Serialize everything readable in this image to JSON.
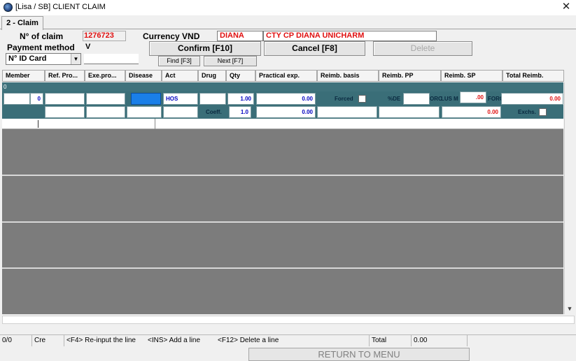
{
  "window": {
    "title": "[Lisa / SB] CLIENT CLAIM",
    "close_glyph": "✕"
  },
  "tabs": [
    {
      "label": "2 - Claim"
    }
  ],
  "header": {
    "claim_no_label": "N° of claim",
    "claim_no_value": "1276723",
    "currency_label": "Currency VND",
    "client_code": "DIANA",
    "client_name": "CTY CP DIANA UNICHARM",
    "payment_method_label": "Payment method",
    "payment_method_value": "V",
    "id_select_value": "N° ID Card",
    "id_value": ""
  },
  "buttons": {
    "confirm": "Confirm [F10]",
    "cancel": "Cancel [F8]",
    "delete": "Delete",
    "find": "Find [F3]",
    "next": "Next [F7]"
  },
  "columns": [
    "Member",
    "Ref. Pro...",
    "Exe.pro...",
    "Disease",
    "Act",
    "Drug",
    "Qty",
    "Practical exp.",
    "Reimb. basis",
    "Reimb. PP",
    "Reimb. SP",
    "Total Reimb."
  ],
  "grid": {
    "row_index": "0",
    "row1": {
      "member": "",
      "member_no": "0",
      "act": "HOS",
      "qty": "1.00",
      "practical_exp": "0.00",
      "forced_label": "Forced",
      "pct_label": "%DE",
      "orc_label": "ORC",
      "lus_label": "LUS",
      "mt_label": "M",
      "sp_value": ".00",
      "forc_label": "FORC",
      "total_reimb": "0.00"
    },
    "row2": {
      "coeff_label": "Coeff.",
      "coeff": "1.0",
      "practical_exp": "0.00",
      "sp_value": "0.00",
      "exchs_label": "Exchs."
    }
  },
  "statusbar": {
    "position": "0/0",
    "mode": "Cre",
    "hint_f4": "<F4> Re-input the line",
    "hint_ins": "<INS> Add a line",
    "hint_f12": "<F12> Delete a line",
    "total_label": "Total",
    "total_value": "0.00"
  },
  "footer": {
    "return_label": "RETURN TO MENU"
  },
  "colors": {
    "accent_red": "#e01010",
    "grid_teal": "#3a6e78",
    "grid_grey": "#7c7c7c",
    "selected_blue": "#1a7fe8",
    "value_blue": "#0000c0"
  }
}
